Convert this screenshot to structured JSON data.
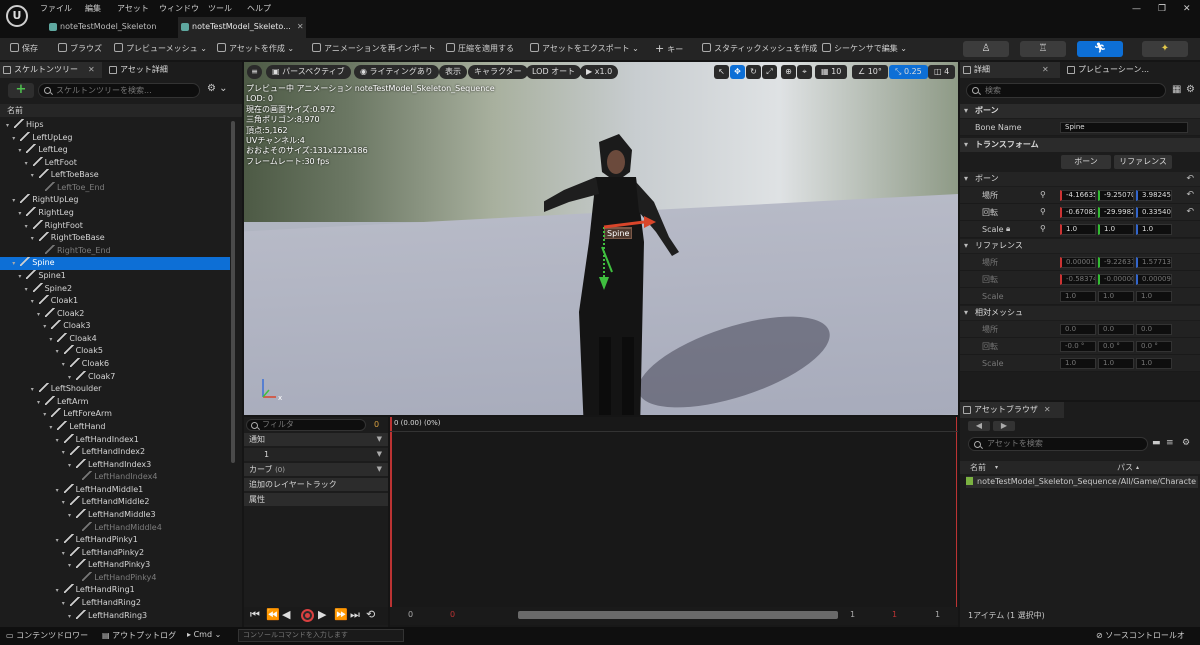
{
  "menu": [
    "ファイル",
    "編集",
    "アセット",
    "ウィンドウ",
    "ツール",
    "ヘルプ"
  ],
  "doc_tabs": [
    "noteTestModel_Skeleton",
    "noteTestModel_Skeleto..."
  ],
  "toolbar": {
    "save": "保存",
    "browse": "ブラウズ",
    "preview_mesh": "プレビューメッシュ",
    "create_asset": "アセットを作成",
    "reimport": "アニメーションを再インポート",
    "apply_compression": "圧縮を適用する",
    "export_asset": "アセットをエクスポート",
    "key": "キー",
    "make_static_mesh": "スタティックメッシュを作成",
    "edit_in_sequencer": "シーケンサで編集"
  },
  "left_panel": {
    "tab_skeleton_tree": "スケルトンツリー",
    "tab_asset_details": "アセット詳細",
    "search_placeholder": "スケルトンツリーを検索...",
    "column_name": "名前",
    "bones": [
      {
        "name": "Hips",
        "depth": 0,
        "end": false
      },
      {
        "name": "LeftUpLeg",
        "depth": 1,
        "end": false
      },
      {
        "name": "LeftLeg",
        "depth": 2,
        "end": false
      },
      {
        "name": "LeftFoot",
        "depth": 3,
        "end": false
      },
      {
        "name": "LeftToeBase",
        "depth": 4,
        "end": false
      },
      {
        "name": "LeftToe_End",
        "depth": 5,
        "end": true
      },
      {
        "name": "RightUpLeg",
        "depth": 1,
        "end": false
      },
      {
        "name": "RightLeg",
        "depth": 2,
        "end": false
      },
      {
        "name": "RightFoot",
        "depth": 3,
        "end": false
      },
      {
        "name": "RightToeBase",
        "depth": 4,
        "end": false
      },
      {
        "name": "RightToe_End",
        "depth": 5,
        "end": true
      },
      {
        "name": "Spine",
        "depth": 1,
        "end": false,
        "selected": true
      },
      {
        "name": "Spine1",
        "depth": 2,
        "end": false
      },
      {
        "name": "Spine2",
        "depth": 3,
        "end": false
      },
      {
        "name": "Cloak1",
        "depth": 4,
        "end": false
      },
      {
        "name": "Cloak2",
        "depth": 5,
        "end": false
      },
      {
        "name": "Cloak3",
        "depth": 6,
        "end": false
      },
      {
        "name": "Cloak4",
        "depth": 7,
        "end": false
      },
      {
        "name": "Cloak5",
        "depth": 8,
        "end": false
      },
      {
        "name": "Cloak6",
        "depth": 9,
        "end": false
      },
      {
        "name": "Cloak7",
        "depth": 10,
        "end": false
      },
      {
        "name": "LeftShoulder",
        "depth": 4,
        "end": false
      },
      {
        "name": "LeftArm",
        "depth": 5,
        "end": false
      },
      {
        "name": "LeftForeArm",
        "depth": 6,
        "end": false
      },
      {
        "name": "LeftHand",
        "depth": 7,
        "end": false
      },
      {
        "name": "LeftHandIndex1",
        "depth": 8,
        "end": false
      },
      {
        "name": "LeftHandIndex2",
        "depth": 9,
        "end": false
      },
      {
        "name": "LeftHandIndex3",
        "depth": 10,
        "end": false
      },
      {
        "name": "LeftHandIndex4",
        "depth": 11,
        "end": true
      },
      {
        "name": "LeftHandMiddle1",
        "depth": 8,
        "end": false
      },
      {
        "name": "LeftHandMiddle2",
        "depth": 9,
        "end": false
      },
      {
        "name": "LeftHandMiddle3",
        "depth": 10,
        "end": false
      },
      {
        "name": "LeftHandMiddle4",
        "depth": 11,
        "end": true
      },
      {
        "name": "LeftHandPinky1",
        "depth": 8,
        "end": false
      },
      {
        "name": "LeftHandPinky2",
        "depth": 9,
        "end": false
      },
      {
        "name": "LeftHandPinky3",
        "depth": 10,
        "end": false
      },
      {
        "name": "LeftHandPinky4",
        "depth": 11,
        "end": true
      },
      {
        "name": "LeftHandRing1",
        "depth": 8,
        "end": false
      },
      {
        "name": "LeftHandRing2",
        "depth": 9,
        "end": false
      },
      {
        "name": "LeftHandRing3",
        "depth": 10,
        "end": false
      }
    ]
  },
  "viewport": {
    "perspective": "パースペクティブ",
    "lighting": "ライティングあり",
    "show": "表示",
    "character": "キャラクター",
    "lod": "LOD オート",
    "play_rate": "x1.0",
    "grid_size": "10",
    "angle": "10°",
    "camera_speed": "0.25",
    "scale_snap": "4",
    "bone_label": "Spine",
    "stats": [
      "プレビュー中 アニメーション noteTestModel_Skeleton_Sequence",
      "LOD: 0",
      "現在の画面サイズ:0.972",
      "三角ポリゴン:8,970",
      "頂点:5,162",
      "UVチャンネル:4",
      "おおよそのサイズ:131x121x186",
      "フレームレート:30 fps"
    ]
  },
  "timeline": {
    "filter_placeholder": "フィルタ",
    "filter_count": "0",
    "tracks": [
      "通知",
      "1",
      "カーブ",
      "追加のレイヤートラック",
      "属性"
    ],
    "curve_count": "(0)",
    "time_label": "0 (0.00) (0%)",
    "bottom_numbers": [
      "0",
      "0",
      "1",
      "1",
      "1"
    ]
  },
  "details": {
    "tab_details": "詳細",
    "tab_preview_scene": "プレビューシーン...",
    "search_placeholder": "検索",
    "sec_bone": "ボーン",
    "bone_name_label": "Bone Name",
    "bone_name_value": "Spine",
    "sec_transform": "トランスフォーム",
    "btn_bone": "ボーン",
    "btn_reference": "リファレンス",
    "sub_bone": "ボーン",
    "location": "場所",
    "rotation": "回転",
    "scale": "Scale",
    "bone_loc": [
      "-4.16635",
      "-9.25070",
      "3.982455"
    ],
    "bone_rot": [
      "-0.67082",
      "-29.9982",
      "0.335404"
    ],
    "bone_scale": [
      "1.0",
      "1.0",
      "1.0"
    ],
    "sub_reference": "リファレンス",
    "ref_loc": [
      "0.000015",
      "-9.22631",
      "1.577133"
    ],
    "ref_rot": [
      "-0.58374",
      "-0.00000",
      "0.000094"
    ],
    "ref_scale": [
      "1.0",
      "1.0",
      "1.0"
    ],
    "sub_relative_mesh": "相対メッシュ",
    "mesh_loc": [
      "0.0",
      "0.0",
      "0.0"
    ],
    "mesh_rot": [
      "-0.0 °",
      "0.0 °",
      "0.0 °"
    ],
    "mesh_scale": [
      "1.0",
      "1.0",
      "1.0"
    ]
  },
  "asset_browser": {
    "tab": "アセットブラウザ",
    "search_placeholder": "アセットを検索",
    "col_name": "名前",
    "col_path": "パス",
    "asset_name": "noteTestModel_Skeleton_Sequence",
    "asset_path": "/All/Game/Characte",
    "count": "1アイテム (1 選択中)"
  },
  "statusbar": {
    "content_drawer": "コンテンツドロワー",
    "output_log": "アウトプットログ",
    "cmd": "Cmd",
    "console_placeholder": "コンソールコマンドを入力します",
    "source_control": "ソースコントロールオ"
  }
}
